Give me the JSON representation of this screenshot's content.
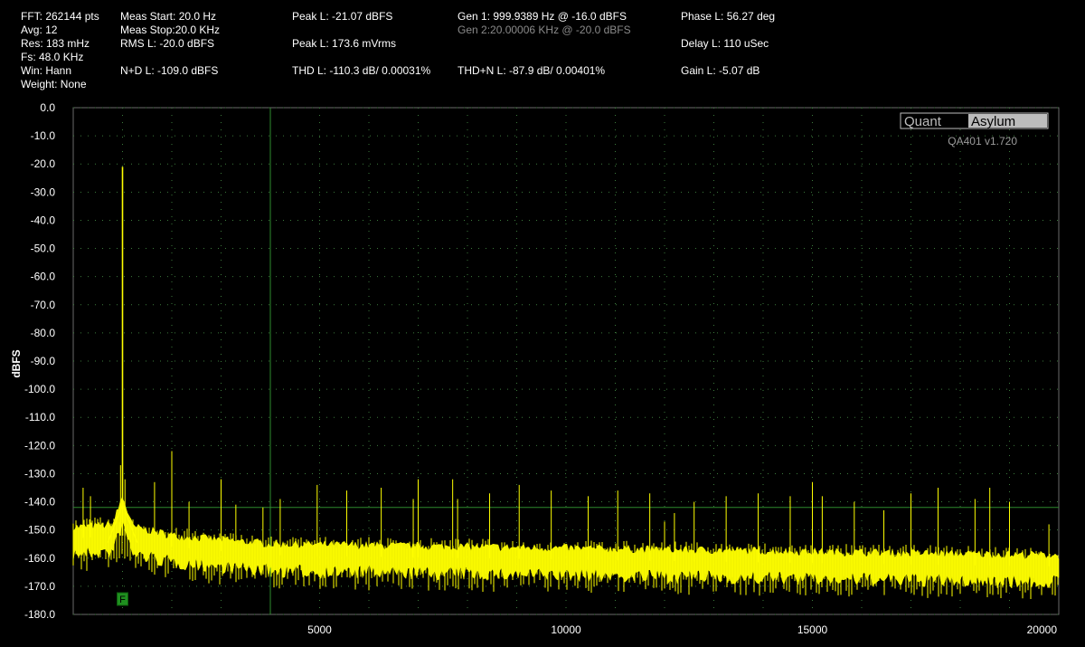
{
  "header": {
    "col1": [
      "FFT: 262144 pts",
      "Avg: 12",
      "Res: 183 mHz",
      "Fs: 48.0 KHz",
      "Win: Hann",
      "Weight: None"
    ],
    "meas_start": "Meas Start: 20.0 Hz",
    "meas_stop": "Meas Stop:20.0 KHz",
    "rms": "RMS L: -20.0 dBFS",
    "nd": "N+D L: -109.0 dBFS",
    "peak_dbfs": "Peak L: -21.07 dBFS",
    "peak_vrms": "Peak L: 173.6 mVrms",
    "thd": "THD L: -110.3 dB/ 0.00031%",
    "gen1": "Gen 1: 999.9389 Hz @ -16.0  dBFS",
    "gen2": "Gen 2:20.00006 KHz @ -20.0  dBFS",
    "thdn": "THD+N L: -87.9 dB/ 0.00401%",
    "phase": "Phase L: 56.27 deg",
    "delay": "Delay L: 110 uSec",
    "gain": "Gain L: -5.07 dB"
  },
  "logo": {
    "part1": "Quant",
    "part2": "Asylum",
    "version": "QA401 v1.720"
  },
  "marker_label": "F",
  "colors": {
    "trace": "#ffff00",
    "grid": "#3c7a3c",
    "cursor": "#2e8b2e",
    "marker": "#1f8f1f"
  },
  "chart_data": {
    "type": "line",
    "title": "",
    "xlabel": "",
    "ylabel": "dBFS",
    "xlim": [
      0,
      20000
    ],
    "ylim": [
      -180,
      0
    ],
    "x_ticks": [
      5000,
      10000,
      15000,
      20000
    ],
    "y_ticks": [
      0,
      -10,
      -20,
      -30,
      -40,
      -50,
      -60,
      -70,
      -80,
      -90,
      -100,
      -110,
      -120,
      -130,
      -140,
      -150,
      -160,
      -170,
      -180
    ],
    "y_tick_labels": [
      "0.0",
      "-10.0",
      "-20.0",
      "-30.0",
      "-40.0",
      "-50.0",
      "-60.0",
      "-70.0",
      "-80.0",
      "-90.0",
      "-100.0",
      "-110.0",
      "-120.0",
      "-130.0",
      "-140.0",
      "-150.0",
      "-160.0",
      "-170.0",
      "-180.0"
    ],
    "grid": true,
    "cursor_x": 4000,
    "reference_level": -142,
    "marker_x": 1000,
    "noise_floor": [
      [
        0,
        -153
      ],
      [
        1000,
        -152
      ],
      [
        2000,
        -156
      ],
      [
        4000,
        -159
      ],
      [
        8000,
        -160
      ],
      [
        12000,
        -161
      ],
      [
        16000,
        -162
      ],
      [
        20000,
        -163
      ]
    ],
    "series": [
      {
        "values": [
          [
            1000,
            -21
          ],
          [
            960,
            -127
          ],
          [
            1050,
            -132
          ],
          [
            2000,
            -122
          ],
          [
            3000,
            -132
          ],
          [
            200,
            -135
          ],
          [
            350,
            -138
          ],
          [
            1650,
            -133
          ],
          [
            2350,
            -140
          ],
          [
            3300,
            -141
          ],
          [
            3850,
            -142
          ],
          [
            4200,
            -139
          ],
          [
            4950,
            -134
          ],
          [
            5550,
            -136
          ],
          [
            6250,
            -135
          ],
          [
            6900,
            -139
          ],
          [
            7000,
            -132
          ],
          [
            7700,
            -132
          ],
          [
            7800,
            -139
          ],
          [
            8450,
            -137
          ],
          [
            9050,
            -134
          ],
          [
            9700,
            -136
          ],
          [
            10450,
            -138
          ],
          [
            11050,
            -136
          ],
          [
            11700,
            -137
          ],
          [
            12000,
            -147
          ],
          [
            12200,
            -144
          ],
          [
            12600,
            -140
          ],
          [
            13250,
            -138
          ],
          [
            13900,
            -137
          ],
          [
            14550,
            -138
          ],
          [
            15000,
            -133
          ],
          [
            15200,
            -138
          ],
          [
            15850,
            -140
          ],
          [
            16450,
            -143
          ],
          [
            17000,
            -137
          ],
          [
            17550,
            -135
          ],
          [
            18300,
            -139
          ],
          [
            18600,
            -135
          ],
          [
            19000,
            -140
          ],
          [
            19800,
            -148
          ]
        ]
      }
    ]
  }
}
